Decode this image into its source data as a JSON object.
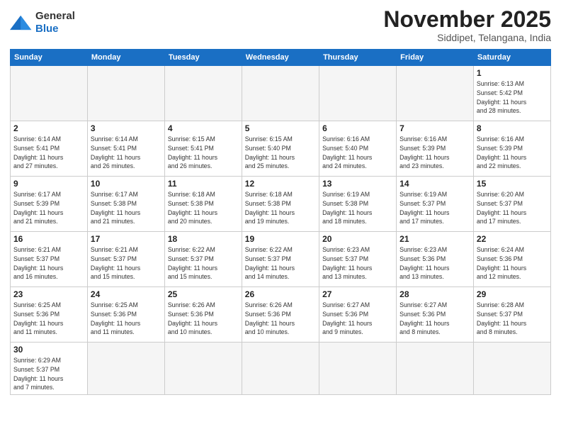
{
  "header": {
    "logo_line1": "General",
    "logo_line2": "Blue",
    "month": "November 2025",
    "location": "Siddipet, Telangana, India"
  },
  "weekdays": [
    "Sunday",
    "Monday",
    "Tuesday",
    "Wednesday",
    "Thursday",
    "Friday",
    "Saturday"
  ],
  "weeks": [
    [
      {
        "day": "",
        "info": ""
      },
      {
        "day": "",
        "info": ""
      },
      {
        "day": "",
        "info": ""
      },
      {
        "day": "",
        "info": ""
      },
      {
        "day": "",
        "info": ""
      },
      {
        "day": "",
        "info": ""
      },
      {
        "day": "1",
        "info": "Sunrise: 6:13 AM\nSunset: 5:42 PM\nDaylight: 11 hours\nand 28 minutes."
      }
    ],
    [
      {
        "day": "2",
        "info": "Sunrise: 6:14 AM\nSunset: 5:41 PM\nDaylight: 11 hours\nand 27 minutes."
      },
      {
        "day": "3",
        "info": "Sunrise: 6:14 AM\nSunset: 5:41 PM\nDaylight: 11 hours\nand 26 minutes."
      },
      {
        "day": "4",
        "info": "Sunrise: 6:15 AM\nSunset: 5:41 PM\nDaylight: 11 hours\nand 26 minutes."
      },
      {
        "day": "5",
        "info": "Sunrise: 6:15 AM\nSunset: 5:40 PM\nDaylight: 11 hours\nand 25 minutes."
      },
      {
        "day": "6",
        "info": "Sunrise: 6:16 AM\nSunset: 5:40 PM\nDaylight: 11 hours\nand 24 minutes."
      },
      {
        "day": "7",
        "info": "Sunrise: 6:16 AM\nSunset: 5:39 PM\nDaylight: 11 hours\nand 23 minutes."
      },
      {
        "day": "8",
        "info": "Sunrise: 6:16 AM\nSunset: 5:39 PM\nDaylight: 11 hours\nand 22 minutes."
      }
    ],
    [
      {
        "day": "9",
        "info": "Sunrise: 6:17 AM\nSunset: 5:39 PM\nDaylight: 11 hours\nand 21 minutes."
      },
      {
        "day": "10",
        "info": "Sunrise: 6:17 AM\nSunset: 5:38 PM\nDaylight: 11 hours\nand 21 minutes."
      },
      {
        "day": "11",
        "info": "Sunrise: 6:18 AM\nSunset: 5:38 PM\nDaylight: 11 hours\nand 20 minutes."
      },
      {
        "day": "12",
        "info": "Sunrise: 6:18 AM\nSunset: 5:38 PM\nDaylight: 11 hours\nand 19 minutes."
      },
      {
        "day": "13",
        "info": "Sunrise: 6:19 AM\nSunset: 5:38 PM\nDaylight: 11 hours\nand 18 minutes."
      },
      {
        "day": "14",
        "info": "Sunrise: 6:19 AM\nSunset: 5:37 PM\nDaylight: 11 hours\nand 17 minutes."
      },
      {
        "day": "15",
        "info": "Sunrise: 6:20 AM\nSunset: 5:37 PM\nDaylight: 11 hours\nand 17 minutes."
      }
    ],
    [
      {
        "day": "16",
        "info": "Sunrise: 6:21 AM\nSunset: 5:37 PM\nDaylight: 11 hours\nand 16 minutes."
      },
      {
        "day": "17",
        "info": "Sunrise: 6:21 AM\nSunset: 5:37 PM\nDaylight: 11 hours\nand 15 minutes."
      },
      {
        "day": "18",
        "info": "Sunrise: 6:22 AM\nSunset: 5:37 PM\nDaylight: 11 hours\nand 15 minutes."
      },
      {
        "day": "19",
        "info": "Sunrise: 6:22 AM\nSunset: 5:37 PM\nDaylight: 11 hours\nand 14 minutes."
      },
      {
        "day": "20",
        "info": "Sunrise: 6:23 AM\nSunset: 5:37 PM\nDaylight: 11 hours\nand 13 minutes."
      },
      {
        "day": "21",
        "info": "Sunrise: 6:23 AM\nSunset: 5:36 PM\nDaylight: 11 hours\nand 13 minutes."
      },
      {
        "day": "22",
        "info": "Sunrise: 6:24 AM\nSunset: 5:36 PM\nDaylight: 11 hours\nand 12 minutes."
      }
    ],
    [
      {
        "day": "23",
        "info": "Sunrise: 6:25 AM\nSunset: 5:36 PM\nDaylight: 11 hours\nand 11 minutes."
      },
      {
        "day": "24",
        "info": "Sunrise: 6:25 AM\nSunset: 5:36 PM\nDaylight: 11 hours\nand 11 minutes."
      },
      {
        "day": "25",
        "info": "Sunrise: 6:26 AM\nSunset: 5:36 PM\nDaylight: 11 hours\nand 10 minutes."
      },
      {
        "day": "26",
        "info": "Sunrise: 6:26 AM\nSunset: 5:36 PM\nDaylight: 11 hours\nand 10 minutes."
      },
      {
        "day": "27",
        "info": "Sunrise: 6:27 AM\nSunset: 5:36 PM\nDaylight: 11 hours\nand 9 minutes."
      },
      {
        "day": "28",
        "info": "Sunrise: 6:27 AM\nSunset: 5:36 PM\nDaylight: 11 hours\nand 8 minutes."
      },
      {
        "day": "29",
        "info": "Sunrise: 6:28 AM\nSunset: 5:37 PM\nDaylight: 11 hours\nand 8 minutes."
      }
    ],
    [
      {
        "day": "30",
        "info": "Sunrise: 6:29 AM\nSunset: 5:37 PM\nDaylight: 11 hours\nand 7 minutes."
      },
      {
        "day": "",
        "info": ""
      },
      {
        "day": "",
        "info": ""
      },
      {
        "day": "",
        "info": ""
      },
      {
        "day": "",
        "info": ""
      },
      {
        "day": "",
        "info": ""
      },
      {
        "day": "",
        "info": ""
      }
    ]
  ]
}
